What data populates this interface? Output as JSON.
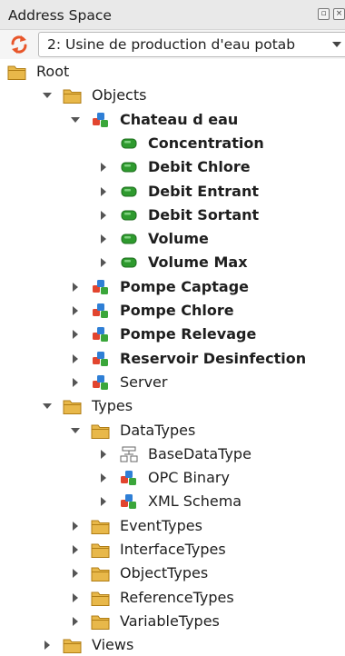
{
  "panel": {
    "title": "Address Space"
  },
  "server_selector": {
    "value": "2: Usine de production d'eau potab"
  },
  "tree": [
    {
      "label": "Root",
      "depth": 0,
      "icon": "folder-icon",
      "expander": "none",
      "bold": false
    },
    {
      "label": "Objects",
      "depth": 1,
      "icon": "folder-icon",
      "expander": "expanded",
      "bold": false
    },
    {
      "label": "Chateau d eau",
      "depth": 2,
      "icon": "object-icon",
      "expander": "expanded",
      "bold": true
    },
    {
      "label": "Concentration",
      "depth": 3,
      "icon": "variable-icon",
      "expander": "none",
      "bold": true
    },
    {
      "label": "Debit Chlore",
      "depth": 3,
      "icon": "variable-icon",
      "expander": "collapsed",
      "bold": true
    },
    {
      "label": "Debit Entrant",
      "depth": 3,
      "icon": "variable-icon",
      "expander": "collapsed",
      "bold": true
    },
    {
      "label": "Debit Sortant",
      "depth": 3,
      "icon": "variable-icon",
      "expander": "collapsed",
      "bold": true
    },
    {
      "label": "Volume",
      "depth": 3,
      "icon": "variable-icon",
      "expander": "collapsed",
      "bold": true
    },
    {
      "label": "Volume Max",
      "depth": 3,
      "icon": "variable-icon",
      "expander": "collapsed",
      "bold": true
    },
    {
      "label": "Pompe Captage",
      "depth": 2,
      "icon": "object-icon",
      "expander": "collapsed",
      "bold": true
    },
    {
      "label": "Pompe Chlore",
      "depth": 2,
      "icon": "object-icon",
      "expander": "collapsed",
      "bold": true
    },
    {
      "label": "Pompe Relevage",
      "depth": 2,
      "icon": "object-icon",
      "expander": "collapsed",
      "bold": true
    },
    {
      "label": "Reservoir Desinfection",
      "depth": 2,
      "icon": "object-icon",
      "expander": "collapsed",
      "bold": true
    },
    {
      "label": "Server",
      "depth": 2,
      "icon": "object-icon",
      "expander": "collapsed",
      "bold": false
    },
    {
      "label": "Types",
      "depth": 1,
      "icon": "folder-icon",
      "expander": "expanded",
      "bold": false
    },
    {
      "label": "DataTypes",
      "depth": 2,
      "icon": "folder-icon",
      "expander": "expanded",
      "bold": false
    },
    {
      "label": "BaseDataType",
      "depth": 3,
      "icon": "datatype-icon",
      "expander": "collapsed",
      "bold": false
    },
    {
      "label": "OPC Binary",
      "depth": 3,
      "icon": "object-icon",
      "expander": "collapsed",
      "bold": false
    },
    {
      "label": "XML Schema",
      "depth": 3,
      "icon": "object-icon",
      "expander": "collapsed",
      "bold": false
    },
    {
      "label": "EventTypes",
      "depth": 2,
      "icon": "folder-icon",
      "expander": "collapsed",
      "bold": false
    },
    {
      "label": "InterfaceTypes",
      "depth": 2,
      "icon": "folder-icon",
      "expander": "collapsed",
      "bold": false
    },
    {
      "label": "ObjectTypes",
      "depth": 2,
      "icon": "folder-icon",
      "expander": "collapsed",
      "bold": false
    },
    {
      "label": "ReferenceTypes",
      "depth": 2,
      "icon": "folder-icon",
      "expander": "collapsed",
      "bold": false
    },
    {
      "label": "VariableTypes",
      "depth": 2,
      "icon": "folder-icon",
      "expander": "collapsed",
      "bold": false
    },
    {
      "label": "Views",
      "depth": 1,
      "icon": "folder-icon",
      "expander": "collapsed",
      "bold": false
    }
  ],
  "colors": {
    "folder": "#e8b84a",
    "folder_dark": "#b07d14",
    "variable": "#2e9a2e",
    "object_red": "#e2452f",
    "object_blue": "#2f7fd6",
    "object_green": "#3aa63a",
    "refresh": "#e8562a"
  }
}
